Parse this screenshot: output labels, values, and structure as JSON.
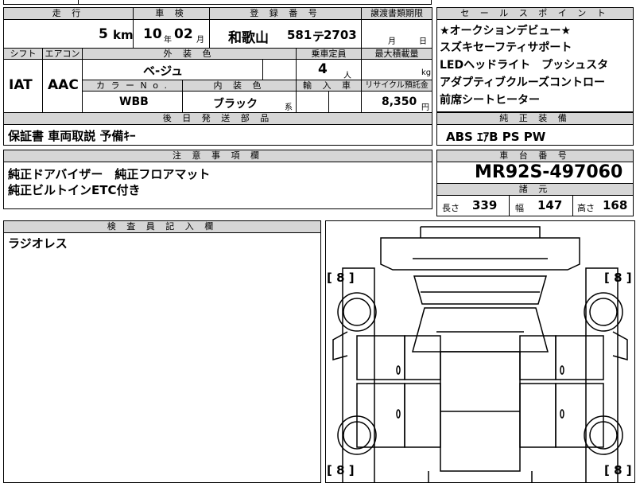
{
  "top": {
    "labels": [
      "走 行",
      "車 検",
      "登 録 番 号",
      "譲渡書類期限"
    ],
    "mileage_value": "5",
    "mileage_unit": "km",
    "shaken_year": "10",
    "shaken_year_unit": "年",
    "shaken_month": "02",
    "shaken_month_unit": "月",
    "reg_area": "和歌山",
    "reg_class": "581",
    "reg_kana": "テ",
    "reg_num": "2703",
    "doc_month_unit": "月",
    "doc_day_unit": "日"
  },
  "row2": {
    "labels": [
      "シフト",
      "エアコン",
      "外 装 色",
      "乗車定員",
      "最大積載量"
    ],
    "shift": "IAT",
    "aircon": "AAC",
    "exterior_color": "ベ-ジュ",
    "capacity": "4",
    "capacity_unit": "人",
    "load_unit": "kg",
    "labels2": [
      "カ ラ ー N o .",
      "内 装 色",
      "輸 入 車",
      "リサイクル預託金"
    ],
    "color_no": "WBB",
    "interior_color": "ブラック",
    "interior_suffix": "系",
    "recycle": "8,350",
    "recycle_unit": "円"
  },
  "later_parts": {
    "label": "後 日 発 送 部 品",
    "value": "保証書 車両取説 予備ｷｰ"
  },
  "notes": {
    "label": "注 意 事 項 欄",
    "lines": [
      "純正ドアバイザー　純正フロアマット",
      "純正ビルトインETC付き"
    ]
  },
  "inspector": {
    "label": "検 査 員 記 入 欄",
    "value": "ラジオレス"
  },
  "sales": {
    "label": "セ ー ル ス ポ イ ン ト",
    "lines": [
      "★オークションデビュー★",
      "スズキセーフティサポート",
      "LEDヘッドライト　プッシュスタ",
      "アダプティブクルーズコントロー",
      "前席シートヒーター"
    ]
  },
  "equipment": {
    "label": "純 正 装 備",
    "value": "ABS ｴｱB PS PW"
  },
  "chassis": {
    "label": "車 台 番 号",
    "value": "MR92S-497060"
  },
  "dims": {
    "label": "諸 元",
    "length_label": "長さ",
    "length": "339",
    "width_label": "幅",
    "width": "147",
    "height_label": "高さ",
    "height": "168"
  },
  "diagram": {
    "tire_tl": "8",
    "tire_tr": "8",
    "tire_bl": "8",
    "tire_br": "8"
  }
}
